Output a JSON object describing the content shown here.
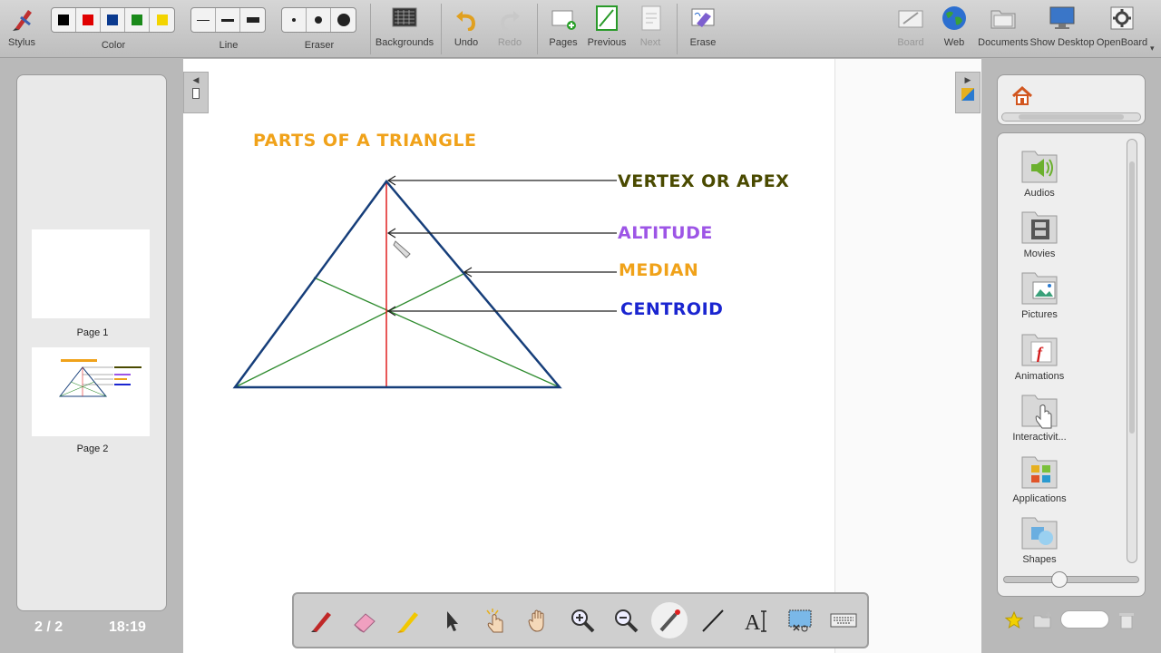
{
  "toolbar": {
    "stylus": "Stylus",
    "color": "Color",
    "line": "Line",
    "eraser": "Eraser",
    "backgrounds": "Backgrounds",
    "undo": "Undo",
    "redo": "Redo",
    "pages": "Pages",
    "previous": "Previous",
    "next": "Next",
    "erase": "Erase",
    "board": "Board",
    "web": "Web",
    "documents": "Documents",
    "show_desktop": "Show Desktop",
    "openboard": "OpenBoard",
    "colors": [
      "#000000",
      "#e00000",
      "#0b3a8f",
      "#1a8a1a",
      "#f3d400"
    ]
  },
  "pages_panel": {
    "pages": [
      {
        "label": "Page 1"
      },
      {
        "label": "Page 2"
      }
    ],
    "counter": "2 / 2",
    "clock": "18:19"
  },
  "board": {
    "title": "PARTS OF A TRIANGLE",
    "labels": {
      "vertex": "VERTEX OR APEX",
      "altitude": "ALTITUDE",
      "median": "MEDIAN",
      "centroid": "CENTROID"
    },
    "colors": {
      "title": "#f0a21a",
      "vertex": "#4a4a00",
      "altitude": "#9d55e6",
      "median": "#f0a21a",
      "centroid": "#1a25d0",
      "triangle": "#163e7a",
      "median_lines": "#2e8b2e",
      "altitude_line": "#e02020"
    }
  },
  "library": {
    "items": [
      {
        "label": "Audios"
      },
      {
        "label": "Movies"
      },
      {
        "label": "Pictures"
      },
      {
        "label": "Animations"
      },
      {
        "label": "Interactivit..."
      },
      {
        "label": "Applications"
      },
      {
        "label": "Shapes"
      }
    ]
  },
  "dock": {
    "tools": [
      "pen-icon",
      "eraser-icon",
      "highlighter-icon",
      "select-icon",
      "interact-icon",
      "hand-icon",
      "zoom-in-icon",
      "zoom-out-icon",
      "laser-pointer-icon",
      "line-icon",
      "text-icon",
      "capture-icon",
      "keyboard-icon"
    ]
  }
}
